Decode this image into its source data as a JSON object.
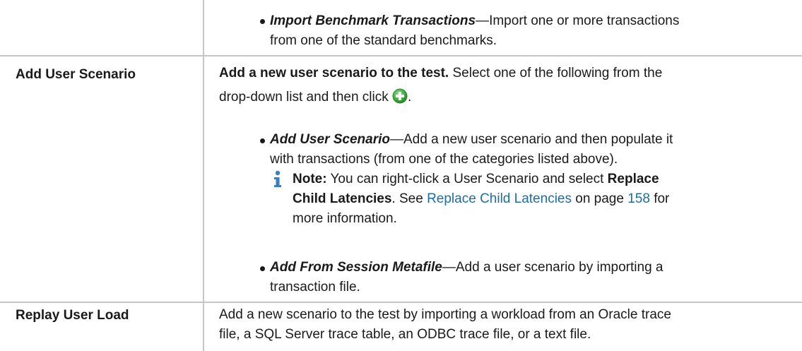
{
  "import_row": {
    "bullet_term": "Import Benchmark Transactions",
    "bullet_dash": "—",
    "bullet_line1": "Import one or more transactions",
    "bullet_line2": "from one of the standard benchmarks."
  },
  "add_user_scenario_row": {
    "label": "Add User Scenario",
    "intro_bold": "Add a new user scenario to the test.",
    "intro_rest": " Select one of the following from the",
    "intro_line2": "drop-down list and then click",
    "intro_end": ".",
    "add_icon": "green-plus-circle-icon",
    "item1_term": "Add User Scenario",
    "item1_line1": "—Add a new user scenario and then populate it",
    "item1_line2": "with transactions (from one of the categories listed above).",
    "note_label": "Note:",
    "note_text1": " You can right-click a User Scenario and select ",
    "note_bold1": "Replace",
    "note_bold2": "Child Latencies",
    "note_text2": ". See ",
    "note_link": "Replace Child Latencies",
    "note_text3": " on page ",
    "note_page": "158",
    "note_text4": " for",
    "note_line3": "more information.",
    "item2_term": "Add From Session Metafile",
    "item2_line1": "—Add a user scenario by importing a",
    "item2_line2": "transaction file."
  },
  "replay_row": {
    "label": "Replay User Load",
    "line1": "Add a new scenario to the test by importing a workload from an Oracle trace",
    "line2": "file, a SQL Server trace table, an ODBC trace file, or a text file."
  },
  "colors": {
    "border": "#c6c6c6",
    "link": "#1b6ea7",
    "add_icon": "#3fae3f",
    "info_icon": "#3a7fc0"
  }
}
